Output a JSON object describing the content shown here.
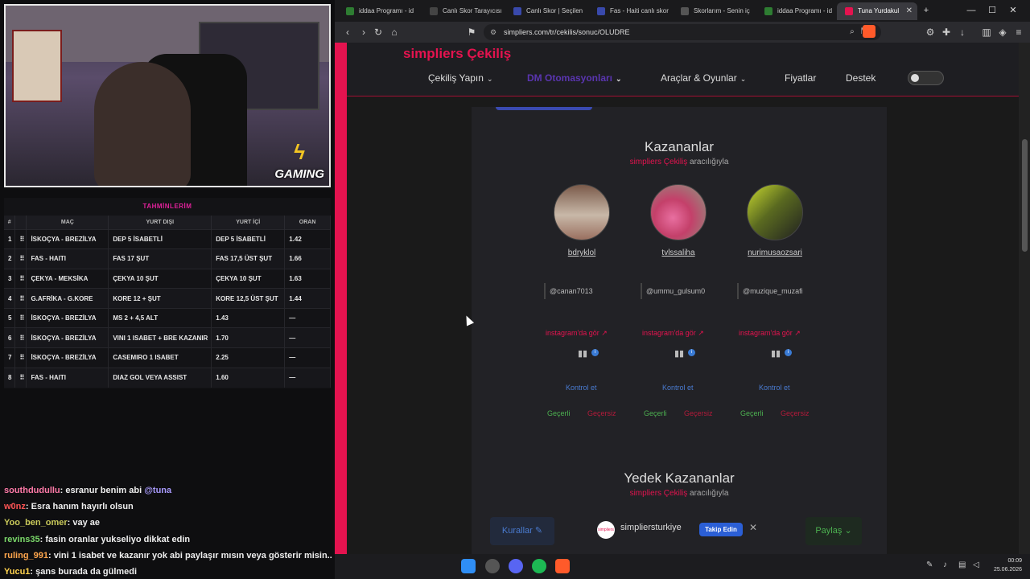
{
  "predictions": {
    "title": "TAHMİNLERİM",
    "headers": [
      "#",
      "MAÇ",
      "YURT DIŞI",
      "YURT İÇİ",
      "ORAN"
    ],
    "rows": [
      {
        "no": "1",
        "match": "İSKOÇYA - BREZİLYA",
        "away": "DEP 5 İSABETLİ",
        "home": "DEP 5 İSABETLİ",
        "odd": "1.42"
      },
      {
        "no": "2",
        "match": "FAS - HAITI",
        "away": "FAS 17 ŞUT",
        "home": "FAS 17,5 ÜST ŞUT",
        "odd": "1.66"
      },
      {
        "no": "3",
        "match": "ÇEKYA - MEKSİKA",
        "away": "ÇEKYA 10 ŞUT",
        "home": "ÇEKYA 10 ŞUT",
        "odd": "1.63"
      },
      {
        "no": "4",
        "match": "G.AFRİKA - G.KORE",
        "away": "KORE 12 + ŞUT",
        "home": "KORE 12,5 ÜST ŞUT",
        "odd": "1.44"
      },
      {
        "no": "5",
        "match": "İSKOÇYA - BREZİLYA",
        "away": "MS 2 + 4,5 ALT",
        "home": "1.43",
        "odd": "—"
      },
      {
        "no": "6",
        "match": "İSKOÇYA - BREZİLYA",
        "away": "VINI 1 ISABET + BRE KAZANIR",
        "home": "1.70",
        "odd": "—"
      },
      {
        "no": "7",
        "match": "İSKOÇYA - BREZİLYA",
        "away": "CASEMIRO 1 ISABET",
        "home": "2.25",
        "odd": "—"
      },
      {
        "no": "8",
        "match": "FAS - HAITI",
        "away": "DIAZ GOL VEYA ASSIST",
        "home": "1.60",
        "odd": "—"
      }
    ]
  },
  "webcam": {
    "logo": "GAMING"
  },
  "chat": [
    {
      "user": "southdudullu",
      "color": "#ff7aa8",
      "msg": ": esranur benim abi ",
      "mention": "@tuna"
    },
    {
      "user": "w0nz",
      "color": "#ff5555",
      "msg": ": Esra hanım hayırlı olsun"
    },
    {
      "user": "Yoo_ben_omer",
      "color": "#c9c95a",
      "msg": ": vay ae"
    },
    {
      "user": "revins35",
      "color": "#7bd96a",
      "msg": ": fasin oranlar yukseliyo dikkat edin"
    },
    {
      "user": "ruling_991",
      "color": "#ffa64d",
      "msg": ": vini 1 isabet ve kazanır yok abi paylaşır mısın veya gösterir misin.."
    },
    {
      "user": "Yucu1",
      "color": "#ffd24d",
      "msg": ": şans burada da gülmedi"
    }
  ],
  "browser": {
    "tabs": [
      "iddaa Programı - id",
      "Canlı Skor Tarayıcısı",
      "Canlı Skor | Seçilen",
      "Fas - Haiti canlı skor",
      "Skorlarım - Senin iç",
      "iddaa Programı - id",
      "Tuna Yurdakul"
    ],
    "url": "simpliers.com/tr/cekilis/sonuc/OLUDRE"
  },
  "site": {
    "brand_a": "simpliers",
    "brand_b": " Çekiliş",
    "nav": [
      "Çekiliş Yapın",
      "DM Otomasyonları",
      "Araçlar & Oyunlar",
      "Fiyatlar",
      "Destek"
    ],
    "winners_title": "Kazananlar",
    "via_a": "simpliers",
    "via_b": " Çekiliş",
    "via_c": " aracılığıyla",
    "winners": [
      {
        "name": "bdryklol",
        "handle": "@canan7013",
        "ig": "instagram'da gör"
      },
      {
        "name": "tvlssaliha",
        "handle": "@ummu_gulsum0",
        "ig": "instagram'da gör"
      },
      {
        "name": "nurimusaozsari",
        "handle": "@muzique_muzafi",
        "ig": "instagram'da gör"
      }
    ],
    "control": "Kontrol et",
    "valid": "Geçerli",
    "invalid": "Geçersiz",
    "backup_title": "Yedek Kazananlar",
    "rules": "Kurallar",
    "follow_name": "simpliersturkiye",
    "follow_btn": "Takip Edin",
    "share": "Paylaş",
    "follow_logo": "simpliers"
  },
  "taskbar": {
    "time": "00:09",
    "date": "25.06.2026"
  },
  "colors": {
    "accent": "#e4134f",
    "link": "#4a7bd0",
    "valid": "#4cb050"
  }
}
